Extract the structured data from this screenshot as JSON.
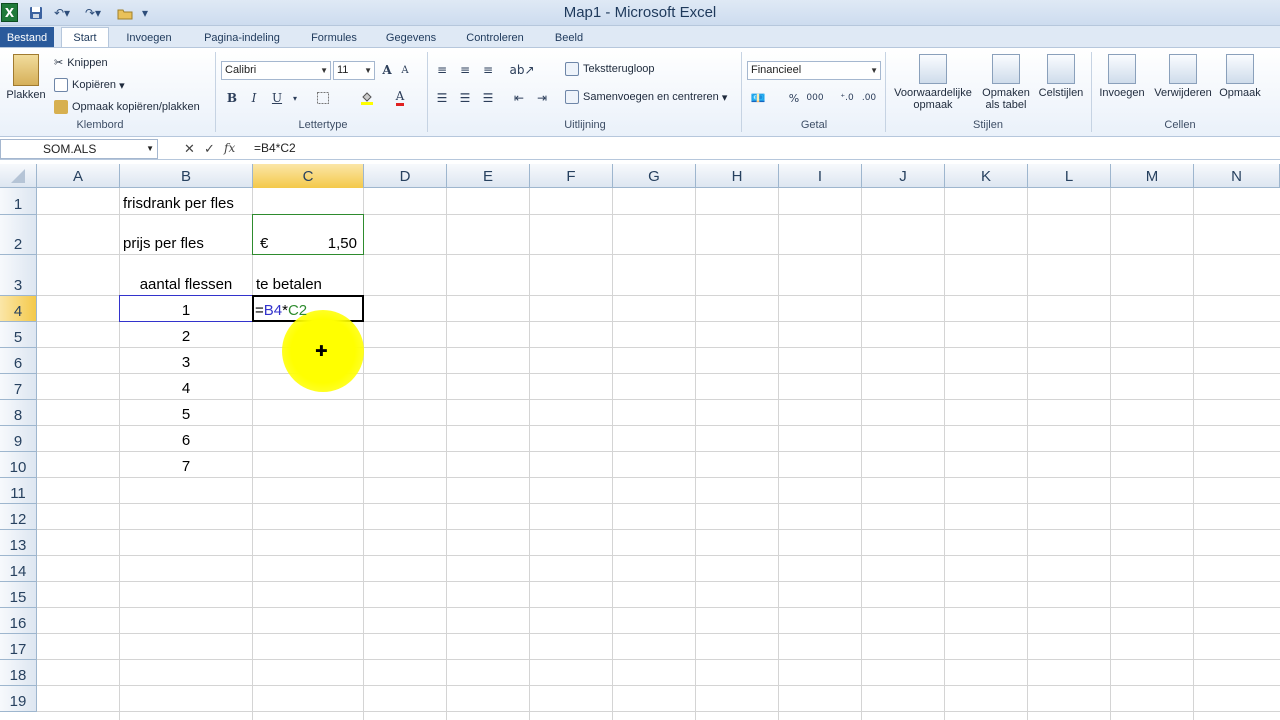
{
  "window": {
    "title": "Map1 - Microsoft Excel"
  },
  "qat": {
    "logo": "X"
  },
  "tabs": [
    "Bestand",
    "Start",
    "Invoegen",
    "Pagina-indeling",
    "Formules",
    "Gegevens",
    "Controleren",
    "Beeld"
  ],
  "ribbon": {
    "clipboard": {
      "paste": "Plakken",
      "cut": "Knippen",
      "copy": "Kopiëren",
      "format_painter": "Opmaak kopiëren/plakken",
      "label": "Klembord"
    },
    "font": {
      "name": "Calibri",
      "size": "11",
      "bold": "B",
      "italic": "I",
      "underline": "U",
      "grow": "A",
      "shrink": "A",
      "font_color": "A",
      "label": "Lettertype"
    },
    "alignment": {
      "wrap": "Tekstterugloop",
      "merge": "Samenvoegen en centreren",
      "label": "Uitlijning"
    },
    "number": {
      "format": "Financieel",
      "label": "Getal"
    },
    "styles": {
      "conditional": "Voorwaardelijke opmaak",
      "table": "Opmaken als tabel",
      "cell_styles": "Celstijlen",
      "label": "Stijlen"
    },
    "cells": {
      "insert": "Invoegen",
      "delete": "Verwijderen",
      "format": "Opmaak",
      "label": "Cellen"
    }
  },
  "formula_bar": {
    "name_box": "SOM.ALS",
    "formula": "=B4*C2"
  },
  "columns": [
    "A",
    "B",
    "C",
    "D",
    "E",
    "F",
    "G",
    "H",
    "I",
    "J",
    "K",
    "L",
    "M",
    "N"
  ],
  "rows": [
    "1",
    "2",
    "3",
    "4",
    "5",
    "6",
    "7",
    "8",
    "9",
    "10",
    "11",
    "12",
    "13",
    "14",
    "15",
    "16",
    "17",
    "18",
    "19"
  ],
  "cells": {
    "B1": "frisdrank per fles",
    "B2": "prijs per fles",
    "C2_symbol": "€",
    "C2_value": "1,50",
    "B3": "aantal flessen",
    "C3": "te betalen",
    "B4": "1",
    "B5": "2",
    "B6": "3",
    "B7": "4",
    "B8": "5",
    "B9": "6",
    "B10": "7",
    "C4_eq": "=",
    "C4_ref1": "B4",
    "C4_op": "*",
    "C4_ref2": "C2"
  },
  "colors": {
    "ref_b4": "#3333cc",
    "ref_c2": "#2e8b2e",
    "highlight": "#ffff00"
  }
}
